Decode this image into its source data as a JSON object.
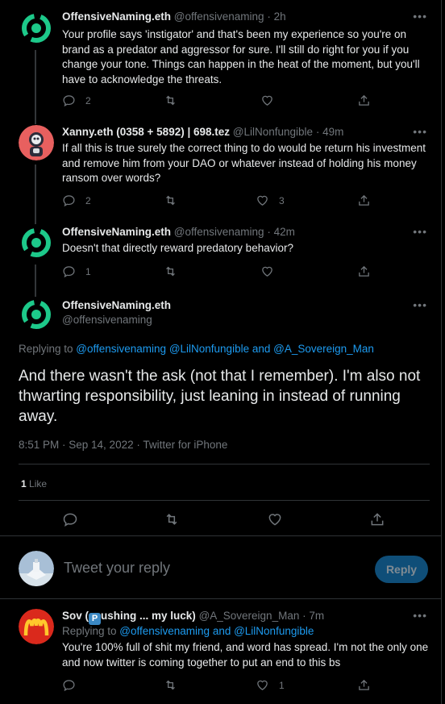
{
  "colors": {
    "accent": "#1d9bf0",
    "muted": "#71767b",
    "text": "#e7e9ea",
    "bg": "#000000",
    "logo_green": "#1dc98a"
  },
  "tweets": [
    {
      "name": "OffensiveNaming.eth",
      "handle": "@offensivenaming",
      "sep": "·",
      "time": "2h",
      "text": "Your profile says 'instigator' and that's been my experience so you're on brand as a predator and aggressor for sure. I'll still do right for you if you change your tone. Things can happen in the heat of the moment, but you'll have to acknowledge the threats.",
      "replies": "2",
      "retweets": "",
      "likes": ""
    },
    {
      "name": "Xanny.eth (0358 + 5892) | 698.tez",
      "handle": "@LilNonfungible",
      "sep": "·",
      "time": "49m",
      "text": "If all this is true surely the correct thing to do would be return his investment and remove him from your DAO or whatever instead of holding his money ransom over words?",
      "replies": "2",
      "retweets": "",
      "likes": "3"
    },
    {
      "name": "OffensiveNaming.eth",
      "handle": "@offensivenaming",
      "sep": "·",
      "time": "42m",
      "text": "Doesn't that directly reward predatory behavior?",
      "replies": "1",
      "retweets": "",
      "likes": ""
    }
  ],
  "focused": {
    "name": "OffensiveNaming.eth",
    "handle": "@offensivenaming",
    "replying_prefix": "Replying to ",
    "replying_links": "@offensivenaming @LilNonfungible and @A_Sovereign_Man",
    "text": "And there wasn't the ask (not that I remember). I'm also not thwarting responsibility, just leaning in instead of running away.",
    "timestamp": "8:51 PM · Sep 14, 2022 · Twitter for iPhone",
    "like_count": "1",
    "like_label": "Like"
  },
  "composer": {
    "placeholder": "Tweet your reply",
    "button": "Reply"
  },
  "reply": {
    "name_prefix": "Sov (",
    "badge": "P",
    "name_suffix": "ushing ... my luck)",
    "handle": "@A_Sovereign_Man",
    "sep": "·",
    "time": "7m",
    "replying_prefix": "Replying to ",
    "replying_links": "@offensivenaming and @LilNonfungible",
    "text": "You're 100% full of shit my friend, and word has spread. I'm not the only one and now twitter is coming together to put an end to this bs",
    "replies": "",
    "retweets": "",
    "likes": "1"
  },
  "more_label": "•••"
}
